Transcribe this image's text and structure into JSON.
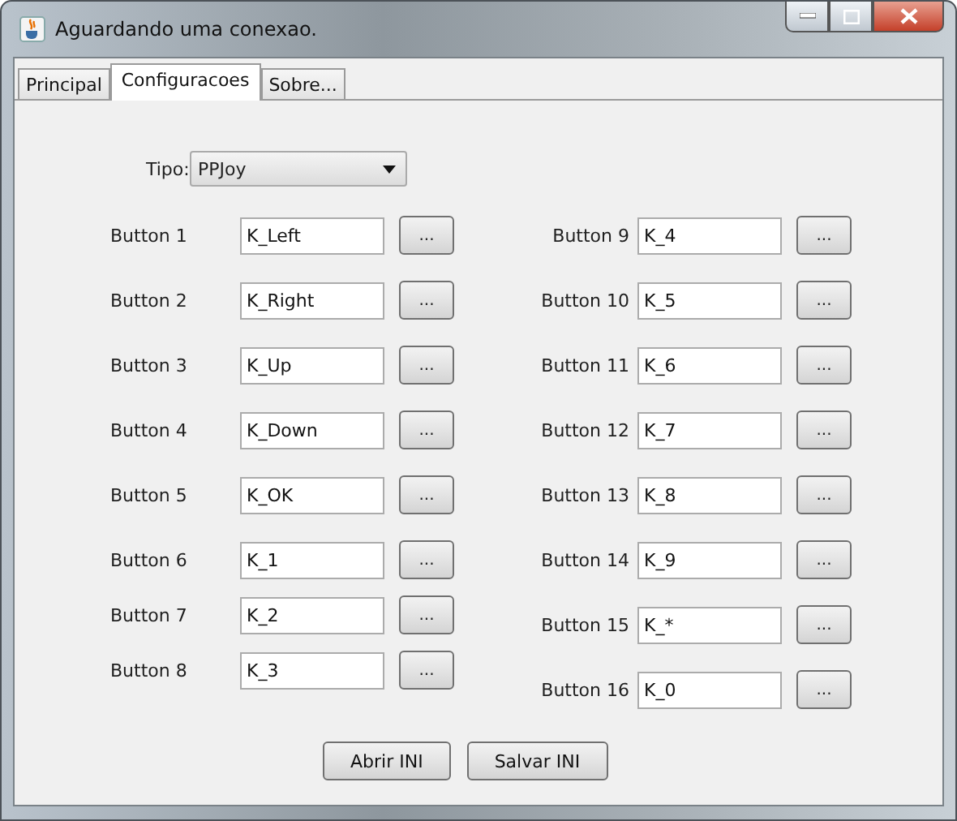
{
  "window": {
    "title": "Aguardando uma conexao."
  },
  "tabs": [
    {
      "label": "Principal",
      "selected": false
    },
    {
      "label": "Configuracoes",
      "selected": true
    },
    {
      "label": "Sobre...",
      "selected": false
    }
  ],
  "tipo": {
    "label": "Tipo:",
    "value": "PPJoy"
  },
  "left_column": [
    {
      "label": "Button 1",
      "value": "K_Left",
      "button": "..."
    },
    {
      "label": "Button 2",
      "value": "K_Right",
      "button": "..."
    },
    {
      "label": "Button 3",
      "value": "K_Up",
      "button": "..."
    },
    {
      "label": "Button 4",
      "value": "K_Down",
      "button": "..."
    },
    {
      "label": "Button 5",
      "value": "K_OK",
      "button": "..."
    },
    {
      "label": "Button 6",
      "value": "K_1",
      "button": "..."
    },
    {
      "label": "Button 7",
      "value": "K_2",
      "button": "..."
    },
    {
      "label": "Button 8",
      "value": "K_3",
      "button": "..."
    }
  ],
  "right_column": [
    {
      "label": "Button 9",
      "value": "K_4",
      "button": "..."
    },
    {
      "label": "Button 10",
      "value": "K_5",
      "button": "..."
    },
    {
      "label": "Button 11",
      "value": "K_6",
      "button": "..."
    },
    {
      "label": "Button 12",
      "value": "K_7",
      "button": "..."
    },
    {
      "label": "Button 13",
      "value": "K_8",
      "button": "..."
    },
    {
      "label": "Button 14",
      "value": "K_9",
      "button": "..."
    },
    {
      "label": "Button 15",
      "value": "K_*",
      "button": "..."
    },
    {
      "label": "Button 16",
      "value": "K_0",
      "button": "..."
    }
  ],
  "actions": [
    "Abrir INI",
    "Salvar INI"
  ]
}
